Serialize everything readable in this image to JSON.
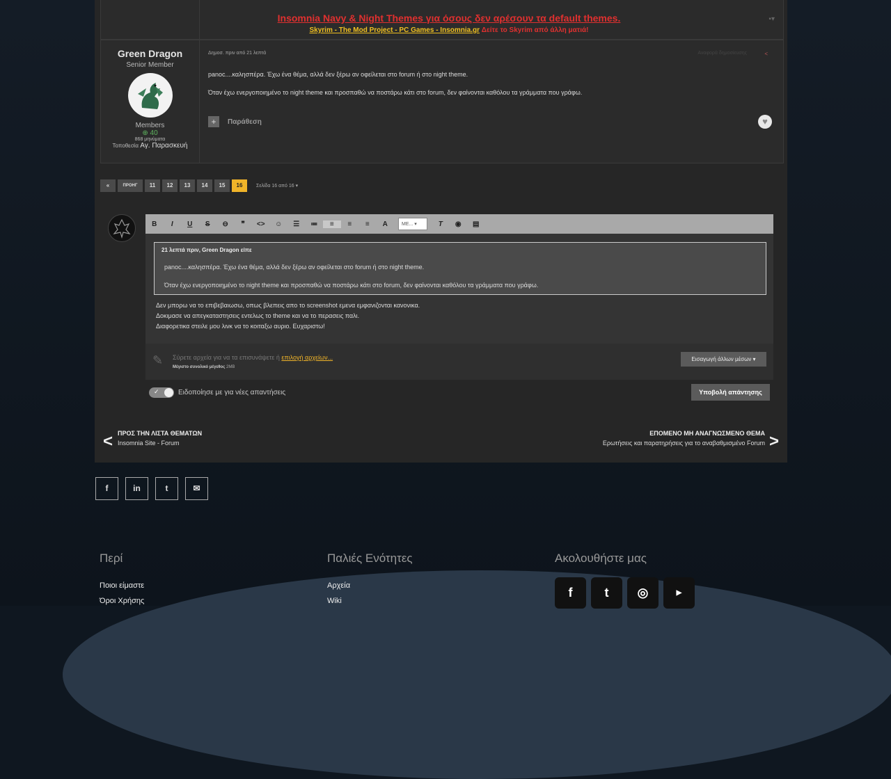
{
  "signature": {
    "line1": "Insomnia Navy & Night Themes για όσους δεν αρέσουν τα default themes.",
    "line2_link": "Skyrim - The Mod Project - PC Games - Insomnia.gr",
    "line2_red": "Δείτε το Skyrim από άλλη ματιά!"
  },
  "post": {
    "author": "Green Dragon",
    "rank": "Senior Member",
    "group": "Members",
    "reputation": "40",
    "posts": "868 μηνύματα",
    "location_label": "Τοποθεσία",
    "location": "Αγ. Παρασκευή",
    "date": "Δημοσ. πριν από 21 λεπτά",
    "report": "Αναφορά δημοσίευσης",
    "line1": "panoc....καλησπέρα. Έχω ένα θέμα, αλλά δεν ξέρω αν οφείλεται στο forum ή στο night theme.",
    "line2": "Όταν έχω ενεργοποιημένο το night theme και προσπαθώ να ποστάρω κάτι στο forum, δεν φαίνονται καθόλου τα γράμματα που γράφω.",
    "quote_label": "Παράθεση"
  },
  "pager": {
    "first": "«",
    "prev": "ΠΡΟΗΓ",
    "pages": [
      "11",
      "12",
      "13",
      "14",
      "15"
    ],
    "current": "16",
    "info": "Σελίδα 16 από 16 ▾"
  },
  "editor": {
    "font_select": "ΜΕ...",
    "quote_head": "21 λεπτά πριν, Green Dragon είπε",
    "quote_line1": "panoc....καλησπέρα. Έχω ένα θέμα, αλλά δεν ξέρω αν οφείλεται στο forum ή στο night theme.",
    "quote_line2": "Όταν έχω ενεργοποιημένο το night theme και προσπαθώ να ποστάρω κάτι στο forum, δεν φαίνονται καθόλου τα γράμματα που γράφω.",
    "reply1": "Δεν μπορω να το επιβεβαιωσω,  οπως βλεπεις απο το screenshot εμενα εμφανιζονται κανονικα.",
    "reply2": "Δοκιμασε να απεγκαταστησεις εντελως το theme και να το περασεις παλι.",
    "reply3": "Διαφορετικα στειλε μου λινκ να το κοιταξω αυριο. Ευχαριστω!"
  },
  "attach": {
    "text": "Σύρετε αρχεία για να τα επισυνάψετε ή",
    "link": "επιλογή αρχείων...",
    "max_label": "Μέγιστο συνολικό μέγεθος",
    "max_value": "2MB",
    "media_button": "Εισαγωγή άλλων μέσων ▾"
  },
  "notify_label": "Ειδοποίησε με για νέες απαντήσεις",
  "submit_label": "Υποβολή απάντησης",
  "nav": {
    "prev_title": "ΠΡΟΣ ΤΗΝ ΛΙΣΤΑ ΘΕΜΑΤΩΝ",
    "prev_sub": "Insomnia Site - Forum",
    "next_title": "ΕΠΟΜΕΝΟ ΜΗ ΑΝΑΓΝΩΣΜΕΝΟ ΘΕΜΑ",
    "next_sub": "Ερωτήσεις και παρατηρήσεις για το αναβαθμισμένο Forum"
  },
  "share_icons": [
    "facebook-icon",
    "linkedin-icon",
    "twitter-icon",
    "email-icon"
  ],
  "footer": {
    "col1_title": "Περί",
    "col1_links": [
      "Ποιοι είμαστε",
      "Όροι Χρήσης"
    ],
    "col2_title": "Παλιές Ενότητες",
    "col2_links": [
      "Αρχεία",
      "Wiki"
    ],
    "col3_title": "Ακολουθήστε μας",
    "follow_icons": [
      "facebook-icon",
      "twitter-icon",
      "instagram-icon",
      "youtube-icon"
    ]
  },
  "colors": {
    "accent": "#f0b429",
    "signature_red": "#e0302f",
    "rep_green": "#5fb35f"
  }
}
